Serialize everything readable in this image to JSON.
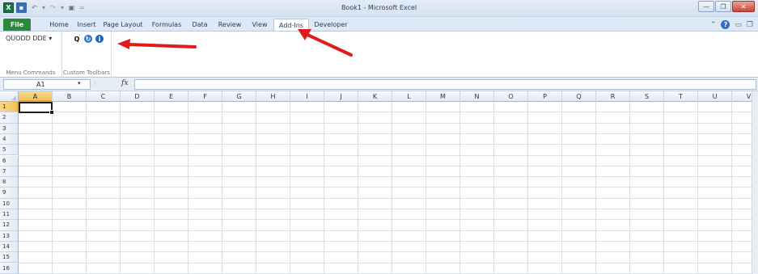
{
  "window": {
    "title": "Book1 - Microsoft Excel",
    "qat_icons": [
      "excel-logo-icon",
      "save-icon",
      "undo-icon",
      "redo-icon",
      "print-preview-icon",
      "customize-qat-icon"
    ],
    "buttons": {
      "minimize": "—",
      "restore": "❐",
      "close": "✕"
    }
  },
  "tabs": [
    "File",
    "Home",
    "Insert",
    "Page Layout",
    "Formulas",
    "Data",
    "Review",
    "View",
    "Add-Ins",
    "Developer"
  ],
  "active_tab": "Add-Ins",
  "ribbon": {
    "menu_commands": {
      "button_label": "QUODD DDE ▾",
      "group_label": "Menu Commands"
    },
    "custom_toolbars": {
      "tools": [
        "Q",
        "↻",
        "i"
      ],
      "group_label": "Custom Toolbars"
    }
  },
  "formula_bar": {
    "name_box": "A1",
    "fx": "fx",
    "content": ""
  },
  "grid": {
    "columns": [
      "A",
      "B",
      "C",
      "D",
      "E",
      "F",
      "G",
      "H",
      "I",
      "J",
      "K",
      "L",
      "M",
      "N",
      "O",
      "P",
      "Q",
      "R",
      "S",
      "T",
      "U",
      "V"
    ],
    "rows": [
      "1",
      "2",
      "3",
      "4",
      "5",
      "6",
      "7",
      "8",
      "9",
      "10",
      "11",
      "12",
      "13",
      "14",
      "15",
      "16"
    ],
    "selected_cell": "A1"
  },
  "colors": {
    "file_tab": "#2a8a3b",
    "annotation_arrow": "#e01b1b",
    "selection_header": "#f3c15e"
  }
}
